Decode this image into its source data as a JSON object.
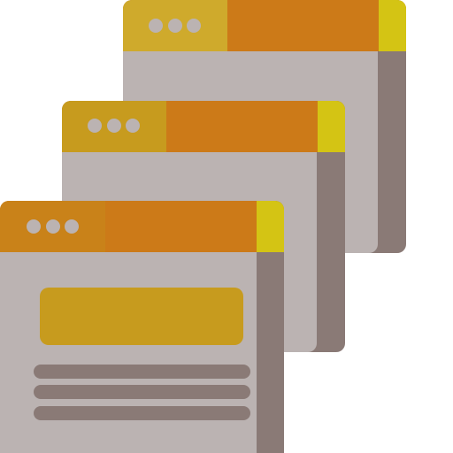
{
  "icon": {
    "name": "stacked-browser-windows",
    "window_count": 3,
    "dots_per_titlebar": 3,
    "text_lines_in_front_window": 3
  },
  "colors": {
    "window_body": "#BBB3B2",
    "window_side_shadow": "#8A7A76",
    "titlebar_orange": "#CC7A18",
    "titlebar_left_tint": "#CFAA2C",
    "titlebar_corner_yellow": "#D4C414",
    "dot": "#BBB3B2",
    "front_banner": "#C79B1E",
    "front_lines": "#8A7A76"
  }
}
